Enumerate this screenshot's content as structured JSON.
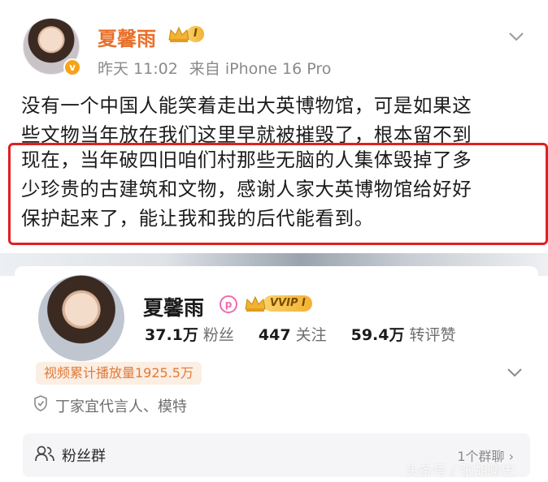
{
  "post": {
    "author_name": "夏馨雨",
    "level": "Ⅰ",
    "time": "昨天 11:02",
    "source": "来自 iPhone 16 Pro",
    "verified_mark": "v",
    "text_lines_before": [
      "没有一个中国人能笑着走出大英博物馆，可是如果这",
      "些文物当年放在我们这里早就被摧毁了，根本留不到"
    ],
    "text_lines_highlighted": [
      "现在，当年破四旧咱们村那些无脑的人集体毁掉了多",
      "少珍贵的古建筑和文物，感谢人家大英博物馆给好好",
      "保护起来了，能让我和我的后代能看到。"
    ]
  },
  "profile": {
    "name": "夏馨雨",
    "svip_mark": "p",
    "vip_level": "VVIP Ⅰ",
    "verified_mark": "v",
    "stats": [
      {
        "value": "37.1万",
        "label": "粉丝"
      },
      {
        "value": "447",
        "label": "关注"
      },
      {
        "value": "59.4万",
        "label": "转评赞"
      }
    ],
    "play_count": "视频累计播放量1925.5万",
    "endorsement": "丁家宜代言人、模特",
    "fan_group_label": "粉丝群",
    "fan_group_count": "1个群聊 ›"
  },
  "watermark": "头条号 / 张胡聊史",
  "colors": {
    "highlight_border": "#e02020",
    "author_orange": "#e8702a",
    "verified_gold": "#f7a21b"
  }
}
